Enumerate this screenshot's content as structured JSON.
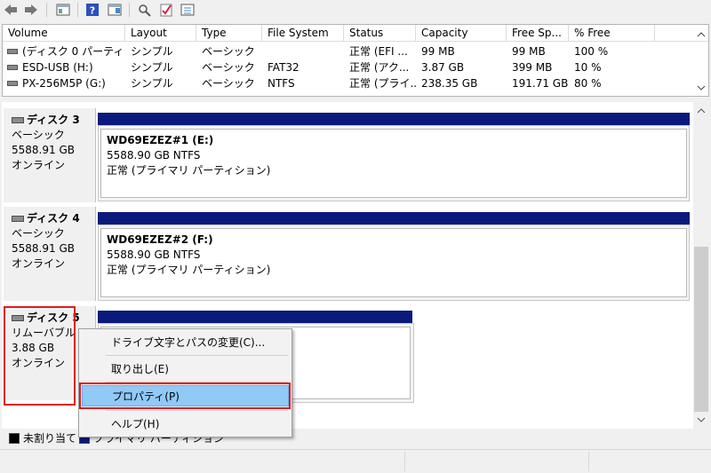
{
  "table": {
    "columns": [
      "Volume",
      "Layout",
      "Type",
      "File System",
      "Status",
      "Capacity",
      "Free Sp...",
      "% Free"
    ],
    "rows": [
      [
        "(ディスク 0 パーティショ...",
        "シンプル",
        "ベーシック",
        "",
        "正常 (EFI ...",
        "99 MB",
        "99 MB",
        "100 %"
      ],
      [
        "ESD-USB (H:)",
        "シンプル",
        "ベーシック",
        "FAT32",
        "正常 (アク...",
        "3.87 GB",
        "399 MB",
        "10 %"
      ],
      [
        "PX-256M5P (G:)",
        "シンプル",
        "ベーシック",
        "NTFS",
        "正常 (プライ...",
        "238.35 GB",
        "191.71 GB",
        "80 %"
      ]
    ]
  },
  "disks": [
    {
      "name": "ディスク 3",
      "type": "ベーシック",
      "size": "5588.91 GB",
      "state": "オンライン",
      "partition": {
        "title": "WD69EZEZ#1  (E:)",
        "detail": "5588.90 GB NTFS",
        "status": "正常 (プライマリ パーティション)"
      }
    },
    {
      "name": "ディスク 4",
      "type": "ベーシック",
      "size": "5588.91 GB",
      "state": "オンライン",
      "partition": {
        "title": "WD69EZEZ#2  (F:)",
        "detail": "5588.90 GB NTFS",
        "status": "正常 (プライマリ パーティション)"
      }
    },
    {
      "name": "ディスク 5",
      "type": "リムーバブル",
      "size": "3.88 GB",
      "state": "オンライン"
    }
  ],
  "legend": {
    "unallocated": "未割り当て",
    "primary": "プライマリ パーティション"
  },
  "context_menu": {
    "items": [
      "ドライブ文字とパスの変更(C)...",
      "取り出し(E)",
      "プロパティ(P)",
      "ヘルプ(H)"
    ],
    "highlighted": "プロパティ(P)"
  },
  "colors": {
    "partition_bar": "#0a1a7c",
    "highlight": "#91c9f7",
    "callout": "#e0191c"
  }
}
